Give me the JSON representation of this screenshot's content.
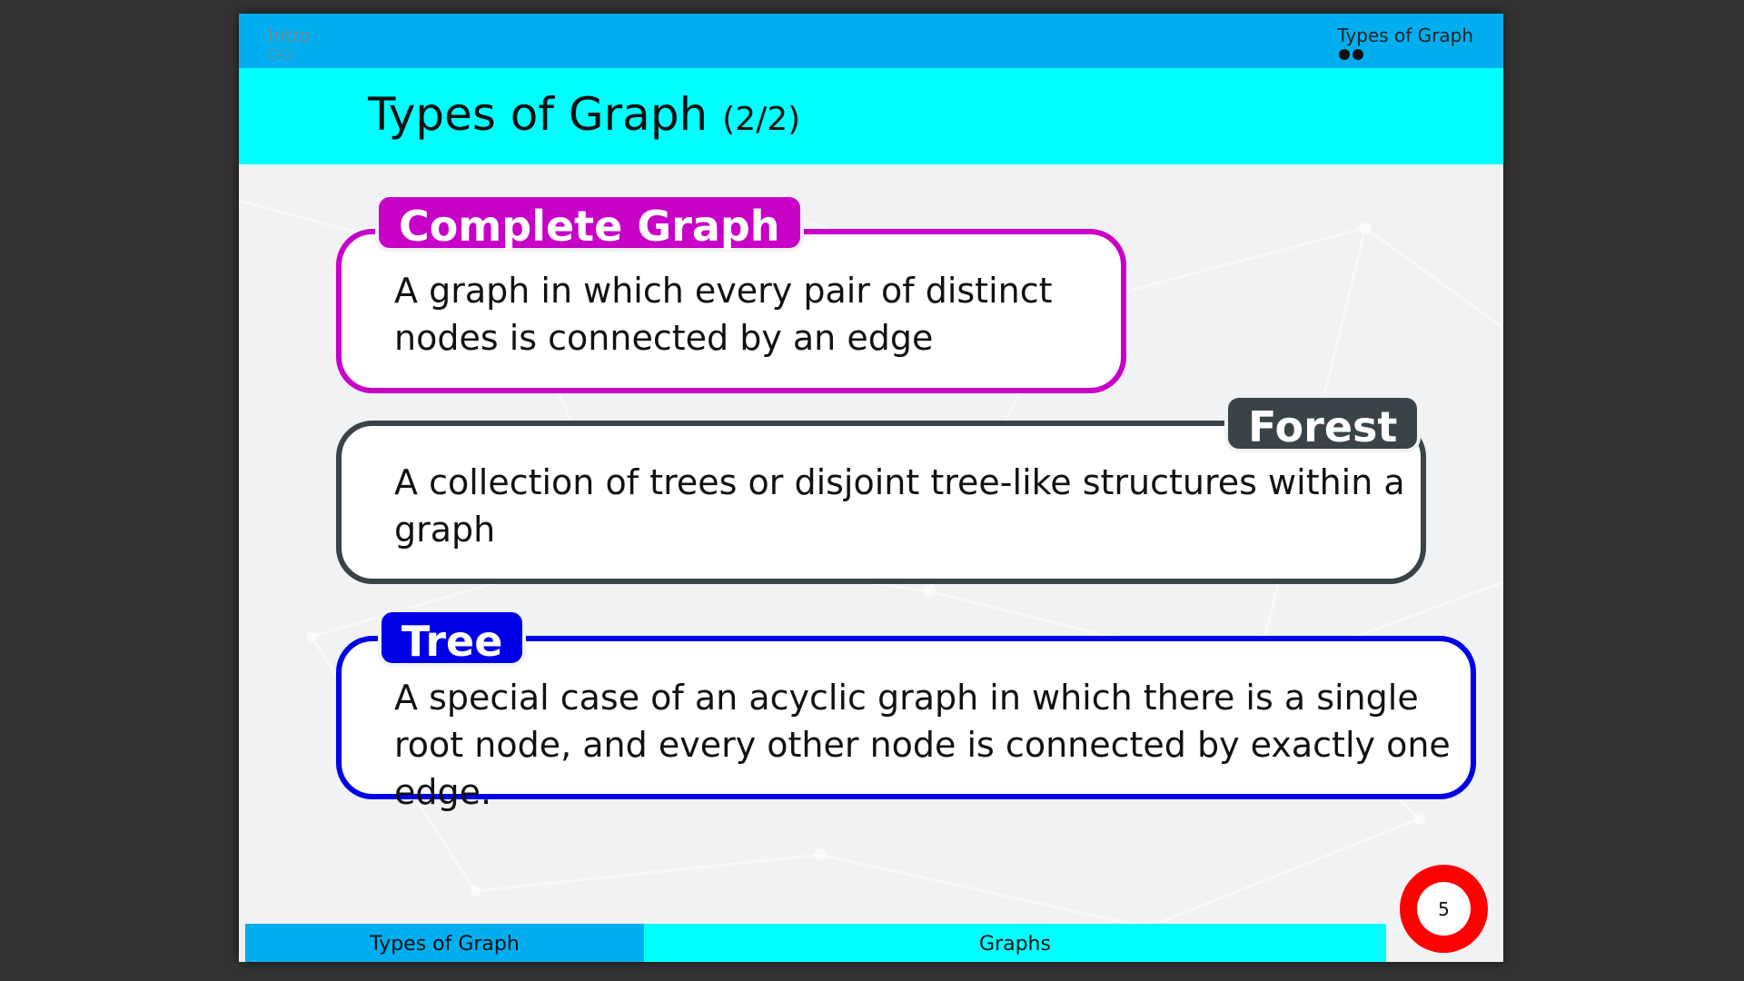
{
  "header": {
    "nav_left": "Intro",
    "nav_right": "Types of Graph"
  },
  "title": {
    "main": "Types of Graph",
    "sub": "(2/2)"
  },
  "blocks": [
    {
      "tag": "Complete Graph",
      "text": "A graph in which every pair of distinct nodes is connected by an edge",
      "color": "#c800c8"
    },
    {
      "tag": "Forest",
      "text": "A collection of trees or disjoint tree-like structures within a graph",
      "color": "#3a4347"
    },
    {
      "tag": "Tree",
      "text": "A special case of an acyclic graph in which there is a single root node, and every other node is connected by exactly one edge.",
      "color": "#0000e6"
    }
  ],
  "footer": {
    "section": "Types of Graph",
    "title": "Graphs",
    "page": "5"
  },
  "colors": {
    "topbar": "#00aeef",
    "titlebar": "#00ffff",
    "page_badge": "#ff0000"
  }
}
